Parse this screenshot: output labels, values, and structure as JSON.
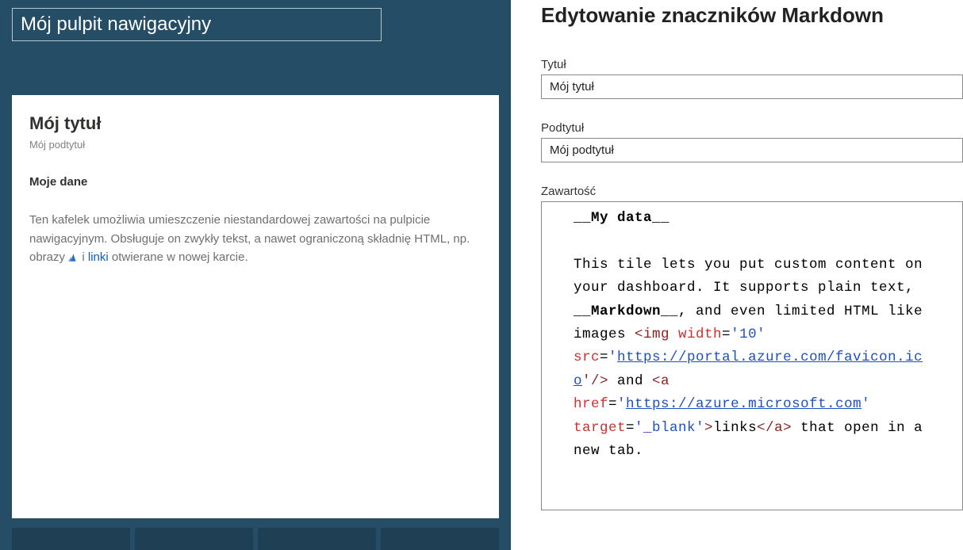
{
  "dashboard": {
    "title": "Mój pulpit nawigacyjny",
    "tile": {
      "title": "Mój tytuł",
      "subtitle": "Mój podtytuł",
      "section_head": "Moje dane",
      "body_before_icon": "Ten kafelek umożliwia umieszczenie niestandardowej zawartości na pulpicie nawigacyjnym. Obsługuje on zwykły tekst, a nawet ograniczoną składnię HTML, np. obrazy ",
      "body_between": " i ",
      "link_text": "linki",
      "body_after_link": " otwierane w nowej karcie."
    }
  },
  "editor": {
    "panel_title": "Edytowanie znaczników Markdown",
    "title_field": {
      "label": "Tytuł",
      "value": "Mój tytuł"
    },
    "subtitle_field": {
      "label": "Podtytuł",
      "value": "Mój podtytuł"
    },
    "content_field": {
      "label": "Zawartość"
    },
    "code": {
      "l1_bold": "__My data__",
      "l3_a": "This tile lets you put custom content on your dashboard. It supports plain text, ",
      "l3_bold": "__Markdown__",
      "l3_b": ", and even limited HTML like images ",
      "img_open": "<img",
      "img_attr_width": " width",
      "img_eq1": "=",
      "img_val_width": "'10'",
      "img_attr_src": " src",
      "img_eq2": "=",
      "img_val_src_q": "'",
      "img_val_src_url": "https://portal.azure.com/favicon.ico",
      "img_close": "'/>",
      "mid": " and ",
      "a_open": "<a",
      "a_attr_href": " href",
      "a_eq1": "=",
      "a_val_href_q": "'",
      "a_val_href_url": "https://azure.microsoft.com",
      "a_val_href_q2": "'",
      "a_attr_target": " target",
      "a_eq2": "=",
      "a_val_target": "'_blank'",
      "a_close_open": ">",
      "a_text": "links",
      "a_close": "</a>",
      "tail": " that open in a new tab."
    }
  }
}
